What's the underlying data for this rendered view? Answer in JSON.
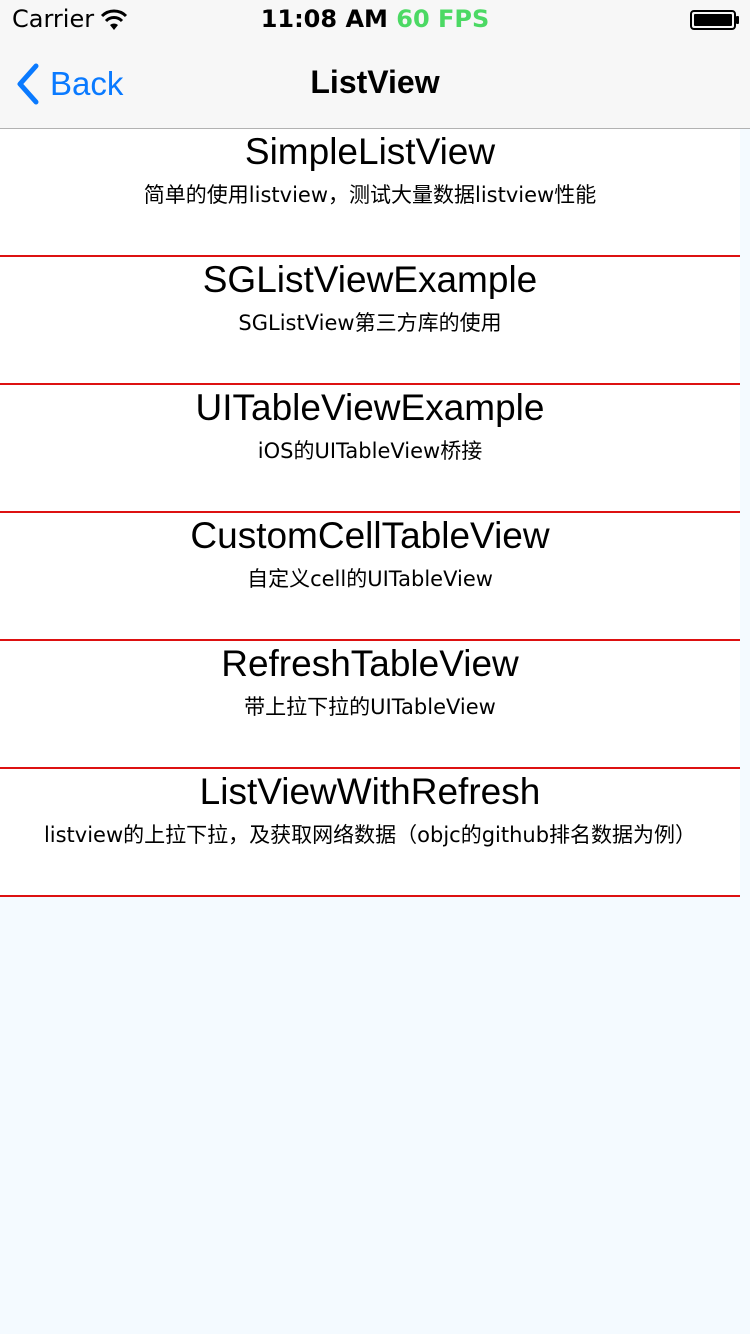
{
  "status_bar": {
    "carrier": "Carrier",
    "time": "11:08 AM",
    "fps": "60 FPS",
    "wifi_icon": "wifi-icon",
    "battery_icon": "battery-icon"
  },
  "nav": {
    "back_label": "Back",
    "back_icon": "chevron-left-icon",
    "title": "ListView",
    "accent_color": "#0a7aff"
  },
  "list": {
    "separator_color": "#dd1111",
    "items": [
      {
        "title": "SimpleListView",
        "subtitle": "简单的使用listview，测试大量数据listview性能"
      },
      {
        "title": "SGListViewExample",
        "subtitle": "SGListView第三方库的使用"
      },
      {
        "title": "UITableViewExample",
        "subtitle": "iOS的UITableView桥接"
      },
      {
        "title": "CustomCellTableView",
        "subtitle": "自定义cell的UITableView"
      },
      {
        "title": "RefreshTableView",
        "subtitle": "带上拉下拉的UITableView"
      },
      {
        "title": "ListViewWithRefresh",
        "subtitle": "listview的上拉下拉，及获取网络数据（objc的github排名数据为例）"
      }
    ]
  }
}
